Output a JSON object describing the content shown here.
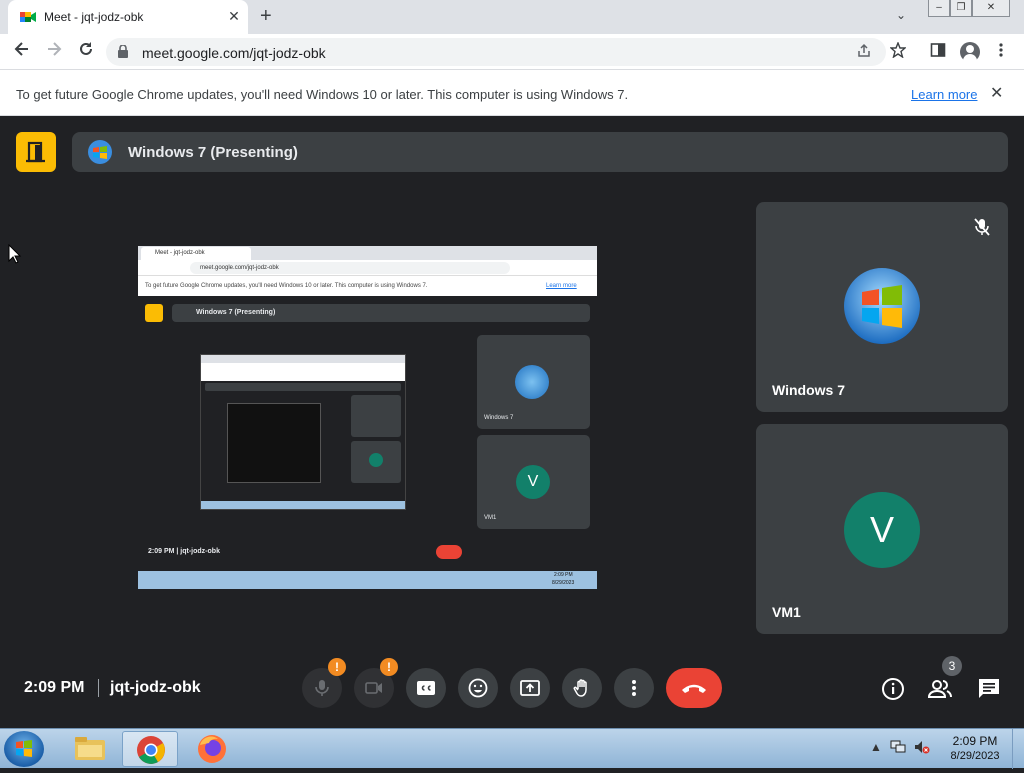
{
  "browser": {
    "tab_title": "Meet - jqt-jodz-obk",
    "tab_close": "✕",
    "new_tab": "+",
    "tab_search": "⌄",
    "url": "meet.google.com/jqt-jodz-obk",
    "window_buttons": [
      "–",
      "❐",
      "✕"
    ]
  },
  "infobar": {
    "message": "To get future Google Chrome updates, you'll need Windows 10 or later. This computer is using Windows 7.",
    "learn_more": "Learn more",
    "close": "✕"
  },
  "meet": {
    "presenting_title": "Windows 7 (Presenting)",
    "participants": [
      {
        "name": "Windows 7",
        "avatar": "windows-logo",
        "muted": true
      },
      {
        "name": "VM1",
        "avatar_letter": "V",
        "muted": false
      }
    ],
    "time": "2:09 PM",
    "separator": "|",
    "meeting_code": "jqt-jodz-obk",
    "warning_mark": "!",
    "participant_count": "3",
    "colors": {
      "accent": "#fbbc04",
      "hangup": "#ea4335",
      "avatar_v": "#12806a",
      "background": "#202124",
      "tile": "#3c4043"
    }
  },
  "shared_screen": {
    "tab_title": "Meet - jqt-jodz-obk",
    "url": "meet.google.com/jqt-jodz-obk",
    "infobar_message": "To get future Google Chrome updates, you'll need Windows 10 or later. This computer is using Windows 7.",
    "learn_more": "Learn more",
    "presenting_title": "Windows 7 (Presenting)",
    "tile1_name": "Windows 7",
    "tile2_name": "VM1",
    "tile2_letter": "V",
    "time_code": "2:09 PM  |  jqt-jodz-obk",
    "taskbar_time": "2:09 PM",
    "taskbar_date": "8/29/2023"
  },
  "taskbar": {
    "apps": [
      "file-explorer",
      "chrome",
      "firefox"
    ],
    "time": "2:09 PM",
    "date": "8/29/2023"
  }
}
